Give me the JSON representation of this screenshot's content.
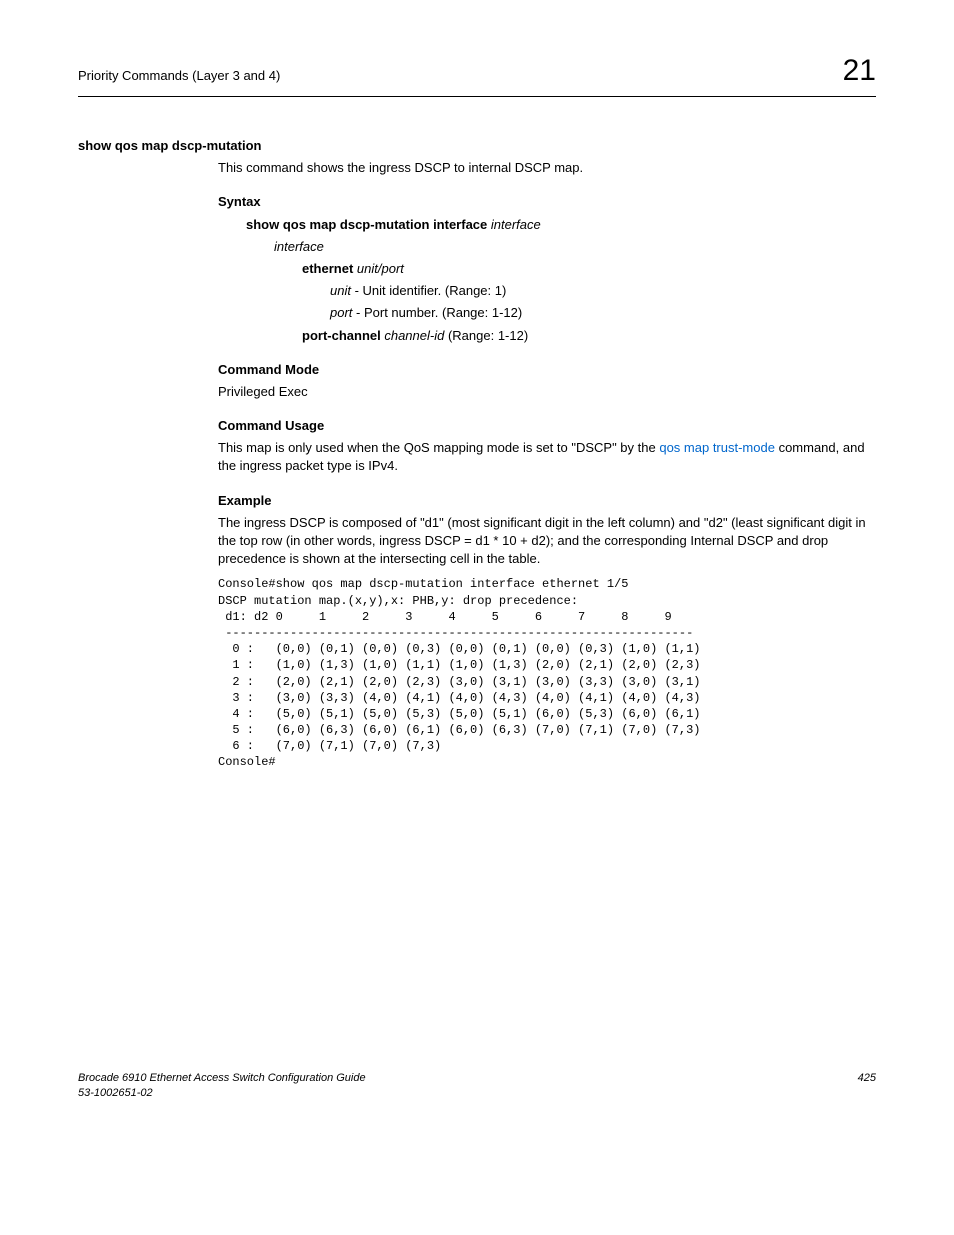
{
  "header": {
    "left": "Priority Commands (Layer 3 and 4)",
    "right": "21"
  },
  "section_title": "show qos map dscp-mutation",
  "intro": "This command shows the ingress DSCP to internal DSCP map.",
  "syntax": {
    "heading": "Syntax",
    "cmd_bold": "show qos map dscp-mutation interface",
    "cmd_ital": " interface",
    "interface": "interface",
    "eth_bold": "ethernet",
    "eth_ital": " unit/port",
    "unit_ital": "unit",
    "unit_desc": " - Unit identifier. (Range: 1)",
    "port_ital": "port",
    "port_desc": " - Port number. (Range: 1-12)",
    "pc_bold": "port-channel",
    "pc_ital": " channel-id",
    "pc_desc": " (Range: 1-12)"
  },
  "mode": {
    "heading": "Command Mode",
    "text": "Privileged Exec"
  },
  "usage": {
    "heading": "Command Usage",
    "text_pre": "This map is only used when the QoS mapping mode is set to \"DSCP\" by the ",
    "link": "qos map trust-mode",
    "text_post": " command, and the ingress packet type is IPv4."
  },
  "example": {
    "heading": "Example",
    "text": "The ingress DSCP is composed of \"d1\" (most significant digit in the left column) and \"d2\" (least significant digit in the top row (in other words, ingress DSCP = d1 * 10 + d2); and the corresponding Internal DSCP and drop precedence is shown at the intersecting cell in the table."
  },
  "console": "Console#show qos map dscp-mutation interface ethernet 1/5\nDSCP mutation map.(x,y),x: PHB,y: drop precedence:\n d1: d2 0     1     2     3     4     5     6     7     8     9\n -----------------------------------------------------------------\n  0 :   (0,0) (0,1) (0,0) (0,3) (0,0) (0,1) (0,0) (0,3) (1,0) (1,1)\n  1 :   (1,0) (1,3) (1,0) (1,1) (1,0) (1,3) (2,0) (2,1) (2,0) (2,3)\n  2 :   (2,0) (2,1) (2,0) (2,3) (3,0) (3,1) (3,0) (3,3) (3,0) (3,1)\n  3 :   (3,0) (3,3) (4,0) (4,1) (4,0) (4,3) (4,0) (4,1) (4,0) (4,3)\n  4 :   (5,0) (5,1) (5,0) (5,3) (5,0) (5,1) (6,0) (5,3) (6,0) (6,1)\n  5 :   (6,0) (6,3) (6,0) (6,1) (6,0) (6,3) (7,0) (7,1) (7,0) (7,3)\n  6 :   (7,0) (7,1) (7,0) (7,3)\nConsole#",
  "footer": {
    "left_line1": "Brocade 6910 Ethernet Access Switch Configuration Guide",
    "left_line2": "53-1002651-02",
    "page": "425"
  }
}
